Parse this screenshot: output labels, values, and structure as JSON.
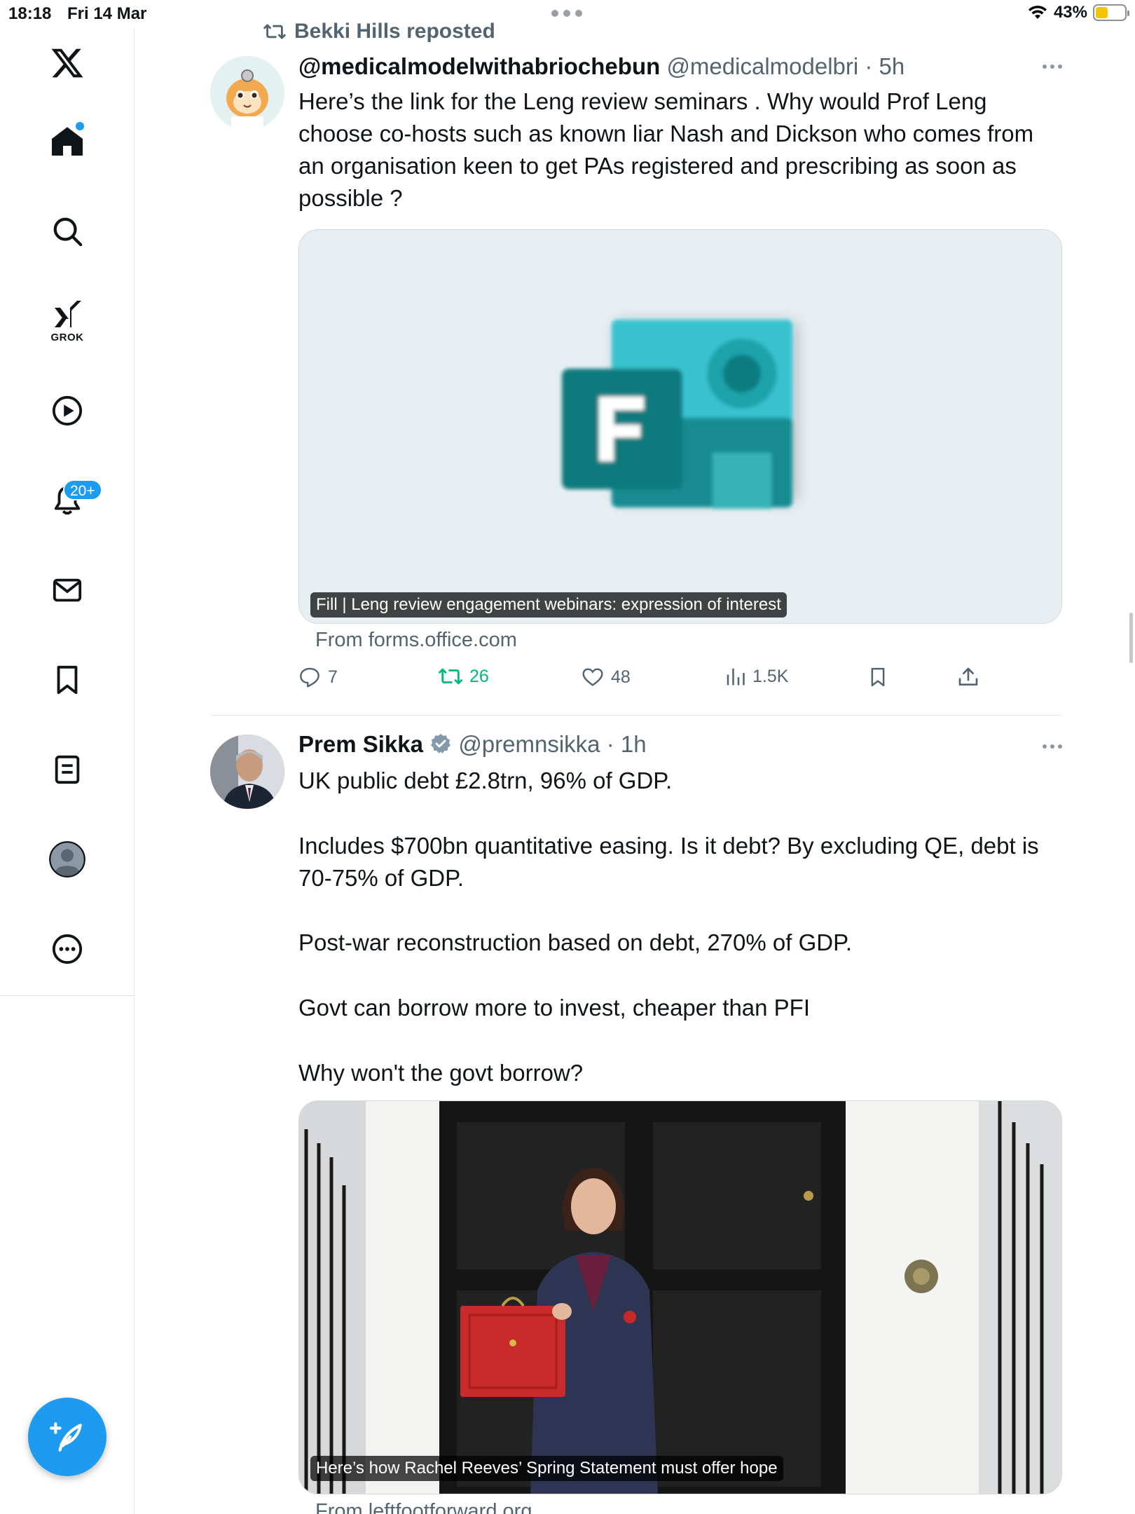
{
  "status_bar": {
    "time": "18:18",
    "date": "Fri 14 Mar",
    "battery": "43%",
    "battery_level": 0.43
  },
  "sidebar": {
    "logo_icon": "x-logo-icon",
    "items": [
      {
        "icon": "home-icon",
        "active": true
      },
      {
        "icon": "search-icon"
      },
      {
        "icon": "grok-icon",
        "label": "GROK"
      },
      {
        "icon": "video-play-icon"
      },
      {
        "icon": "bell-icon",
        "badge": "20+"
      },
      {
        "icon": "mail-icon"
      },
      {
        "icon": "bookmark-icon"
      },
      {
        "icon": "lists-icon"
      },
      {
        "icon": "profile-icon"
      },
      {
        "icon": "more-icon"
      }
    ],
    "compose_icon": "compose-feather-icon"
  },
  "tweets": [
    {
      "reposted_by": "Bekki Hills reposted",
      "name": "@medicalmodelwithabriochebun",
      "handle_time": "@medicalmodelbri · 5h",
      "text": "Here’s the link for the Leng review seminars . Why would Prof Leng choose co-hosts such as known liar Nash and Dickson who comes from an organisation keen to get PAs registered and prescribing as soon as possible ?",
      "card": {
        "caption": "Fill | Leng review engagement webinars: expression of interest",
        "source": "From forms.office.com",
        "image": "microsoft-forms-logo"
      },
      "actions": {
        "replies": "7",
        "reposts": "26",
        "likes": "48",
        "views": "1.5K"
      }
    },
    {
      "name": "Prem Sikka",
      "verified": true,
      "handle_time": "@premnsikka · 1h",
      "paragraphs": [
        "UK public debt £2.8trn, 96% of GDP.",
        "Includes $700bn quantitative easing. Is it debt? By excluding QE, debt is 70-75% of GDP.",
        "Post-war reconstruction based on debt, 270% of GDP.",
        "Govt can borrow more to invest, cheaper than PFI",
        "Why won't the govt borrow?"
      ],
      "card": {
        "caption": "Here’s how Rachel Reeves’ Spring Statement must offer hope",
        "source": "From leftfootforward.org",
        "image": "photo-woman-red-budget-box"
      }
    }
  ],
  "colors": {
    "accent": "#1d9bf0",
    "retweet_green": "#00ba7c",
    "secondary_text": "#536471"
  }
}
